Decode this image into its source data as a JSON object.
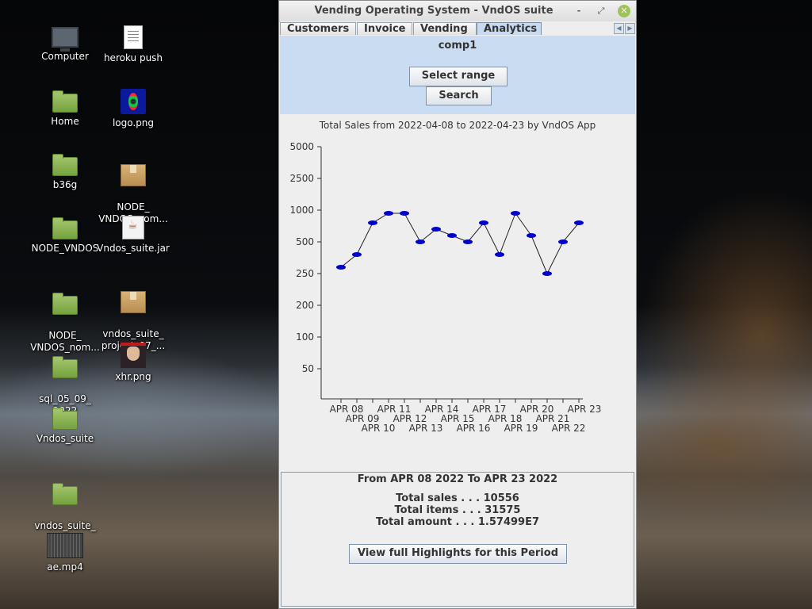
{
  "desktop": {
    "icons": [
      {
        "label": "Computer",
        "icon": "computer-icon"
      },
      {
        "label": "heroku push",
        "icon": "text-file-icon"
      },
      {
        "label": "Home",
        "icon": "home-folder-icon"
      },
      {
        "label": "logo.png",
        "icon": "image-file-icon"
      },
      {
        "label": "b36g",
        "icon": "folder-icon"
      },
      {
        "label": "NODE_\nVNDOS_nom...",
        "icon": "archive-icon"
      },
      {
        "label": "NODE_VNDOS",
        "icon": "folder-icon"
      },
      {
        "label": "Vndos_suite.jar",
        "icon": "java-jar-icon"
      },
      {
        "label": "NODE_\nVNDOS_nom...",
        "icon": "folder-icon"
      },
      {
        "label": "vndos_suite_\nproject_07_...",
        "icon": "archive-icon"
      },
      {
        "label": "sql_05_09_\n2022",
        "icon": "folder-icon"
      },
      {
        "label": "xhr.png",
        "icon": "image-file-icon"
      },
      {
        "label": "Vndos_suite",
        "icon": "folder-icon"
      },
      {
        "label": "vndos_suite_\nproject",
        "icon": "folder-icon"
      },
      {
        "label": "ae.mp4",
        "icon": "video-file-icon"
      }
    ]
  },
  "window": {
    "title": "Vending Operating System - VndOS suite",
    "controls": {
      "minimize": "-",
      "maximize": "⤢",
      "close": "✕"
    },
    "tabs": [
      "Customers",
      "Invoice",
      "Vending",
      "Analytics"
    ],
    "active_tab": "Analytics",
    "company": "comp1",
    "buttons": {
      "select_range": "Select range",
      "search": "Search",
      "highlights": "View full Highlights for this Period"
    },
    "summary": {
      "header": "From APR 08 2022 To APR 23 2022",
      "total_sales": "Total sales . . . 10556",
      "total_items": "Total items . . . 31575",
      "total_amount": "Total amount . . . 1.57499E7"
    }
  },
  "chart_data": {
    "type": "line",
    "title": "Total Sales from 2022-04-08 to 2022-04-23 by VndOS App",
    "xlabel": "",
    "ylabel": "",
    "y_tick_labels": [
      "5000",
      "2500",
      "1000",
      "500",
      "250",
      "200",
      "100",
      "50"
    ],
    "categories": [
      "APR 08",
      "APR 09",
      "APR 10",
      "APR 11",
      "APR 12",
      "APR 13",
      "APR 14",
      "APR 15",
      "APR 16",
      "APR 17",
      "APR 18",
      "APR 19",
      "APR 20",
      "APR 21",
      "APR 22",
      "APR 23"
    ],
    "series": [
      {
        "name": "",
        "values": [
          300,
          400,
          800,
          950,
          950,
          500,
          700,
          600,
          500,
          800,
          400,
          950,
          600,
          250,
          500,
          800
        ]
      }
    ],
    "series_color": "#0000cc",
    "grid": false,
    "legend": "none"
  }
}
